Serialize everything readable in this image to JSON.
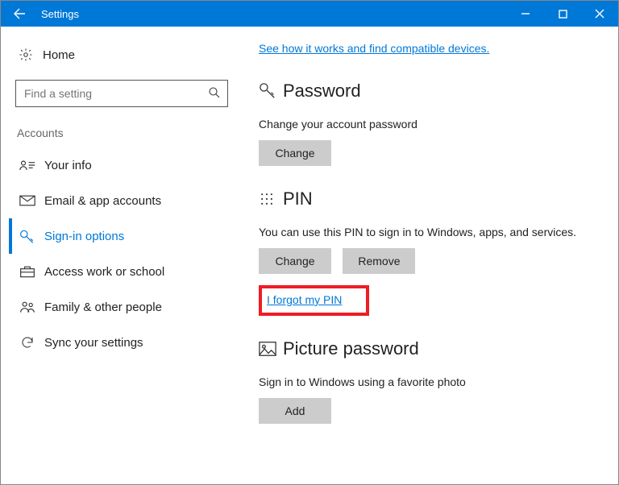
{
  "titlebar": {
    "title": "Settings"
  },
  "sidebar": {
    "home": "Home",
    "search_placeholder": "Find a setting",
    "section": "Accounts",
    "items": [
      {
        "label": "Your info"
      },
      {
        "label": "Email & app accounts"
      },
      {
        "label": "Sign-in options"
      },
      {
        "label": "Access work or school"
      },
      {
        "label": "Family & other people"
      },
      {
        "label": "Sync your settings"
      }
    ]
  },
  "content": {
    "top_link": "See how it works and find compatible devices.",
    "password": {
      "title": "Password",
      "desc": "Change your account password",
      "change": "Change"
    },
    "pin": {
      "title": "PIN",
      "desc": "You can use this PIN to sign in to Windows, apps, and services.",
      "change": "Change",
      "remove": "Remove",
      "forgot": "I forgot my PIN"
    },
    "picture": {
      "title": "Picture password",
      "desc": "Sign in to Windows using a favorite photo",
      "add": "Add"
    }
  }
}
